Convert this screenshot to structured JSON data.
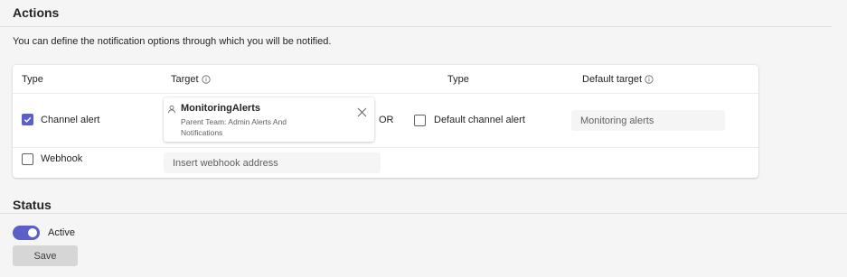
{
  "actions": {
    "title": "Actions",
    "description": "You can define the notification options through which you will be notified.",
    "columns": {
      "type": "Type",
      "target": "Target",
      "type2": "Type",
      "default_target": "Default target"
    },
    "channel_alert": {
      "label": "Channel alert",
      "checked": true,
      "target_name": "MonitoringAlerts",
      "target_subtitle": "Parent Team: Admin Alerts And Notifications",
      "or_text": "OR",
      "default_label": "Default channel alert",
      "default_checked": false,
      "default_target_value": "Monitoring alerts"
    },
    "webhook": {
      "label": "Webhook",
      "checked": false,
      "placeholder": "Insert webhook address"
    }
  },
  "status": {
    "title": "Status",
    "toggle_on": true,
    "toggle_label": "Active",
    "save_label": "Save"
  },
  "colors": {
    "accent": "#5b5fc7",
    "background": "#f5f5f5"
  }
}
